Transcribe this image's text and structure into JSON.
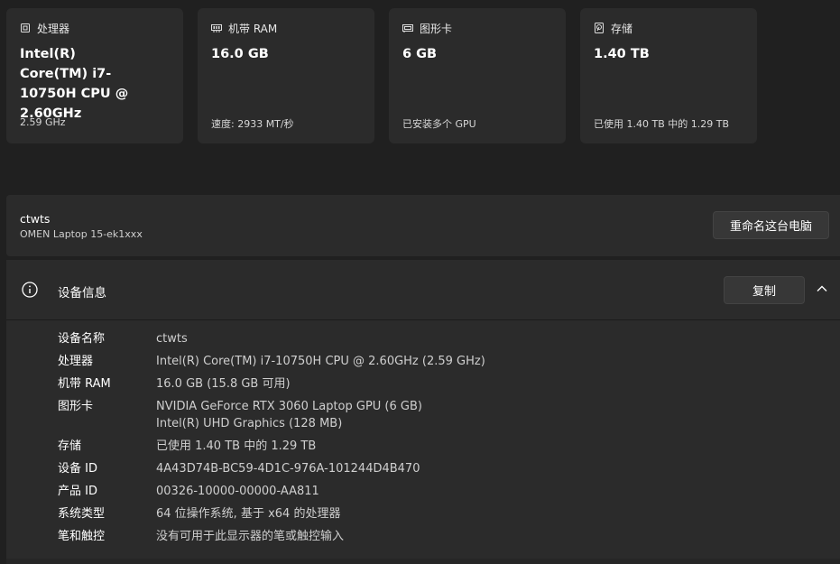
{
  "cards": [
    {
      "icon": "processor-chip-icon",
      "title": "处理器",
      "value": "Intel(R) Core(TM) i7-10750H CPU @ 2.60GHz",
      "sub": "2.59 GHz"
    },
    {
      "icon": "ram-stick-icon",
      "title": "机带 RAM",
      "value": "16.0 GB",
      "sub": "速度: 2933 MT/秒"
    },
    {
      "icon": "graphics-card-icon",
      "title": "图形卡",
      "value": "6 GB",
      "sub": "已安装多个 GPU"
    },
    {
      "icon": "storage-drive-icon",
      "title": "存储",
      "value": "1.40 TB",
      "sub": "已使用 1.40 TB 中的 1.29 TB"
    }
  ],
  "device": {
    "name": "ctwts",
    "model": "OMEN Laptop 15-ek1xxx",
    "rename_label": "重命名这台电脑"
  },
  "device_info": {
    "title": "设备信息",
    "copy_label": "复制",
    "specs": [
      {
        "label": "设备名称",
        "value": "ctwts"
      },
      {
        "label": "处理器",
        "value": "Intel(R) Core(TM) i7-10750H CPU @ 2.60GHz (2.59 GHz)"
      },
      {
        "label": "机带 RAM",
        "value": "16.0 GB (15.8 GB 可用)"
      },
      {
        "label": "图形卡",
        "value": "NVIDIA GeForce RTX 3060 Laptop GPU (6 GB)",
        "value2": "Intel(R) UHD Graphics (128 MB)"
      },
      {
        "label": "存储",
        "value": "已使用 1.40 TB 中的 1.29 TB"
      },
      {
        "label": "设备 ID",
        "value": "4A43D74B-BC59-4D1C-976A-101244D4B470"
      },
      {
        "label": "产品 ID",
        "value": "00326-10000-00000-AA811"
      },
      {
        "label": "系统类型",
        "value": "64 位操作系统, 基于 x64 的处理器"
      },
      {
        "label": "笔和触控",
        "value": "没有可用于此显示器的笔或触控输入"
      }
    ]
  }
}
